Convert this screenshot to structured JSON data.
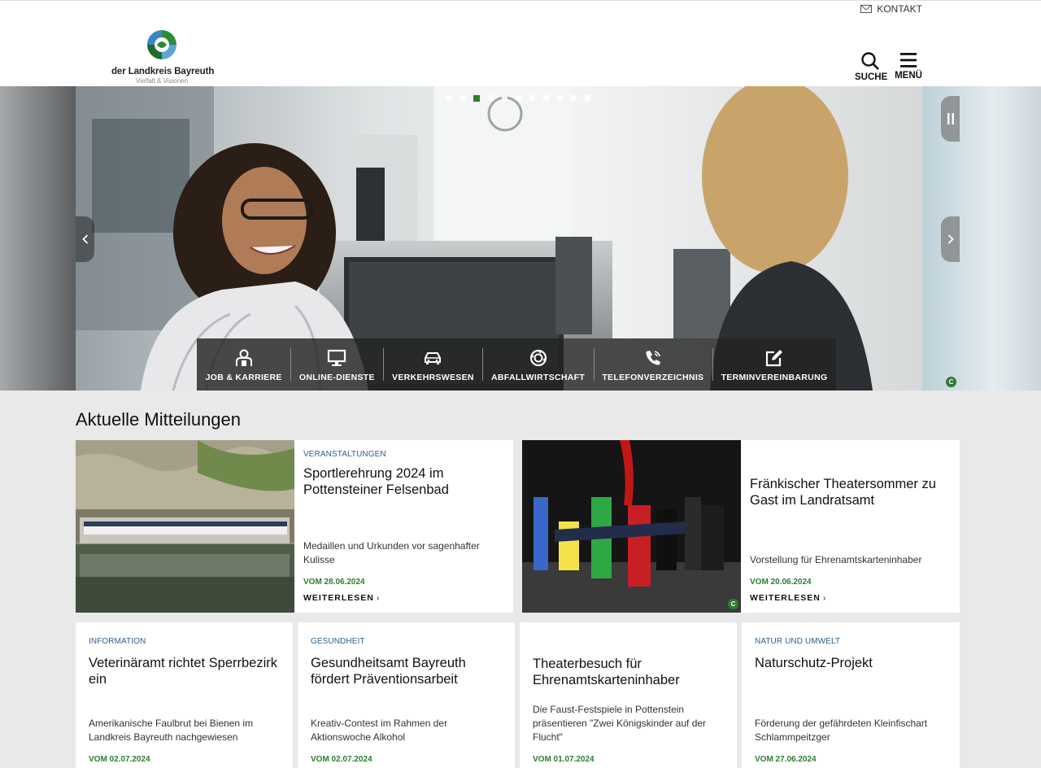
{
  "header": {
    "kontakt_label": "KONTAKT",
    "logo_name": "der Landkreis Bayreuth",
    "logo_tagline": "Vielfalt & Visionen",
    "search_label": "SUCHE",
    "menu_label": "MENÜ"
  },
  "slider": {
    "slide_count": 11,
    "active_slide": 3,
    "copyright_mark": "C",
    "quick_links": [
      {
        "label": "JOB & KARRIERE",
        "icon": "job-icon"
      },
      {
        "label": "ONLINE-DIENSTE",
        "icon": "monitor-icon"
      },
      {
        "label": "VERKEHRSWESEN",
        "icon": "car-icon"
      },
      {
        "label": "ABFALLWIRTSCHAFT",
        "icon": "recycle-icon"
      },
      {
        "label": "TELEFONVERZEICHNIS",
        "icon": "phone-icon"
      },
      {
        "label": "TERMINVEREINBARUNG",
        "icon": "edit-icon"
      }
    ]
  },
  "news": {
    "title": "Aktuelle Mitteilungen",
    "featured": [
      {
        "category": "VERANSTALTUNGEN",
        "title": "Sportlerehrung 2024 im Pottensteiner Felsenbad",
        "teaser": "Medaillen und Urkunden vor sagenhafter Kulisse",
        "date": "VOM 28.06.2024",
        "more": "WEITERLESEN"
      },
      {
        "category": "",
        "title": "Fränkischer Theatersommer zu Gast im Landratsamt",
        "teaser": "Vorstellung für Ehrenamtskarteninhaber",
        "date": "VOM 20.06.2024",
        "more": "WEITERLESEN",
        "copyright_mark": "C"
      }
    ],
    "items": [
      {
        "category": "INFORMATION",
        "title": "Veterinäramt richtet Sperrbezirk ein",
        "teaser": "Amerikanische Faulbrut bei Bienen im Landkreis Bayreuth nachgewiesen",
        "date": "VOM 02.07.2024"
      },
      {
        "category": "GESUNDHEIT",
        "title": "Gesundheitsamt Bayreuth fördert Präventionsarbeit",
        "teaser": "Kreativ-Contest im Rahmen der Aktionswoche Alkohol",
        "date": "VOM 02.07.2024"
      },
      {
        "category": "",
        "title": "Theaterbesuch für Ehrenamtskarteninhaber",
        "teaser": "Die Faust-Festspiele in Pottenstein präsentieren \"Zwei Königskinder auf der Flucht\"",
        "date": "VOM 01.07.2024"
      },
      {
        "category": "NATUR UND UMWELT",
        "title": "Naturschutz-Projekt",
        "teaser": "Förderung der gefährdeten Kleinfischart Schlammpeitzger",
        "date": "VOM 27.06.2024"
      }
    ]
  },
  "colors": {
    "accent_green": "#2e7d32",
    "category_blue": "#2d5e8a"
  }
}
